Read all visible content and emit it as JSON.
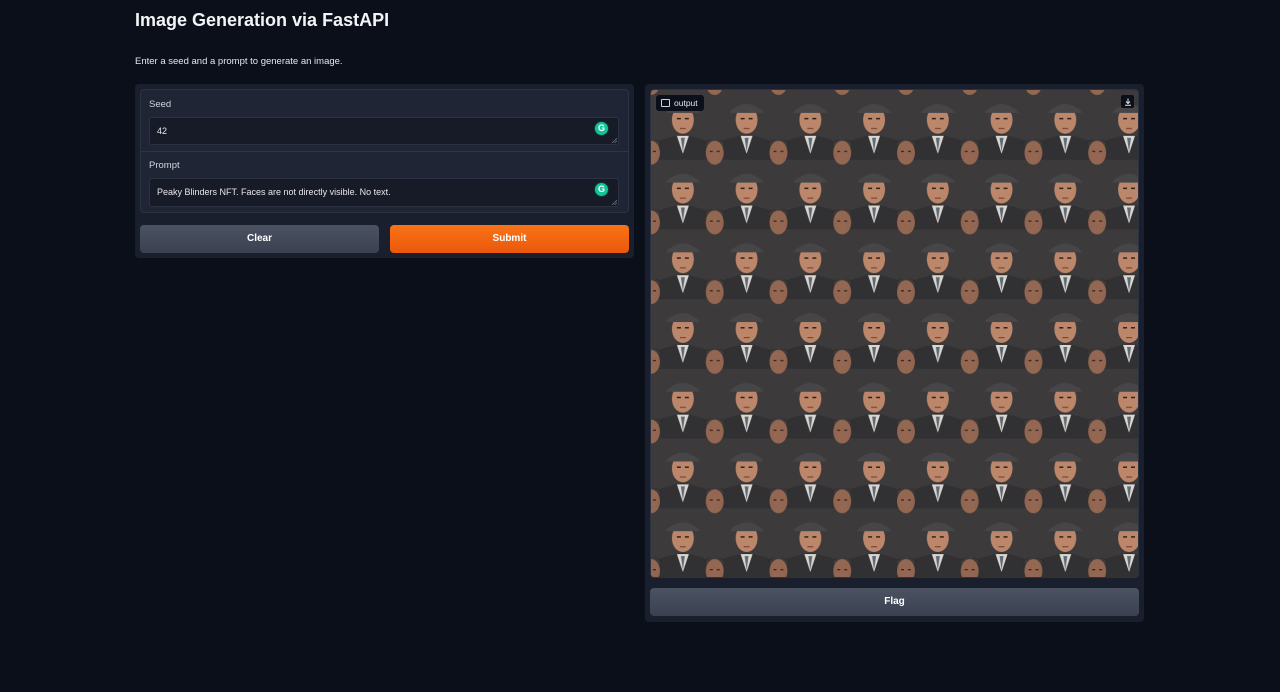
{
  "header": {
    "title": "Image Generation via FastAPI",
    "description": "Enter a seed and a prompt to generate an image."
  },
  "form": {
    "seed": {
      "label": "Seed",
      "value": "42"
    },
    "prompt": {
      "label": "Prompt",
      "value": "Peaky Blinders NFT. Faces are not directly visible. No text."
    },
    "grammarly_icon": "G"
  },
  "buttons": {
    "clear": "Clear",
    "submit": "Submit",
    "flag": "Flag"
  },
  "output": {
    "label": "output",
    "image_icon": "image-icon",
    "download_icon": "download-icon"
  },
  "colors": {
    "background": "#0b0f19",
    "panel": "#1a1f2e",
    "accent": "#f97316",
    "secondary_button": "#4b5262"
  }
}
